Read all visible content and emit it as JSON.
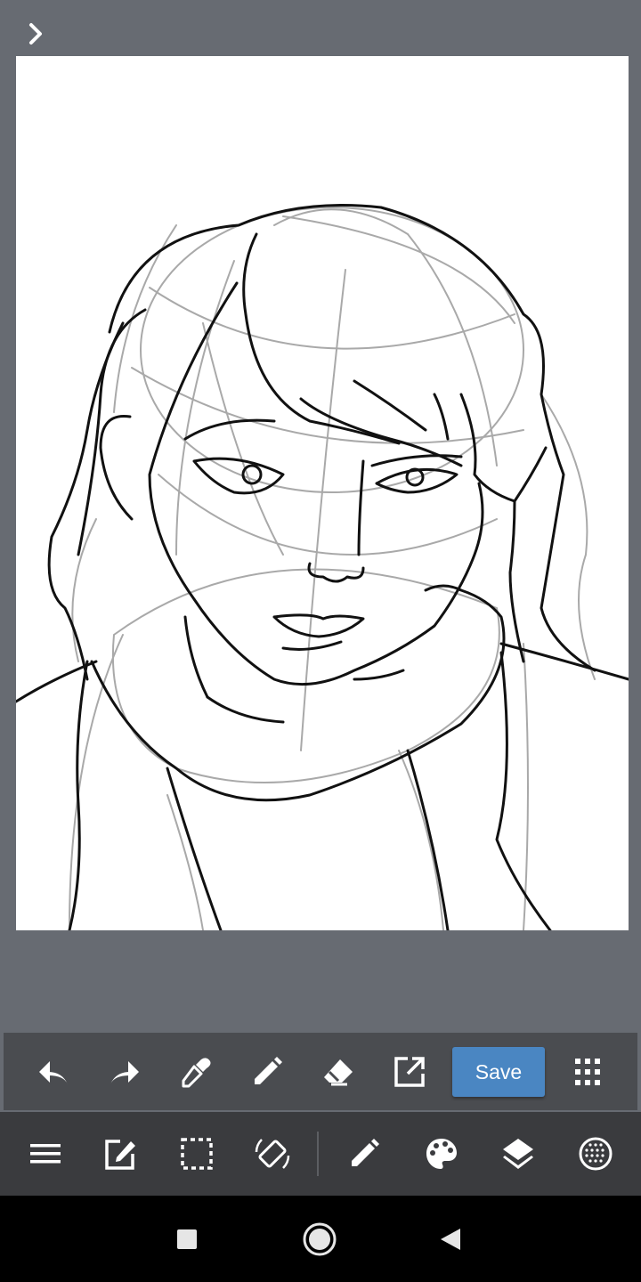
{
  "app": {
    "name": "drawing-editor"
  },
  "topbar": {
    "expand_icon": "chevron-right-icon"
  },
  "canvas": {
    "background": "#ffffff",
    "content": "pencil-sketch-portrait"
  },
  "toolbar_primary": {
    "items": [
      {
        "name": "undo",
        "icon": "undo-icon"
      },
      {
        "name": "redo",
        "icon": "redo-icon"
      },
      {
        "name": "eyedropper",
        "icon": "eyedropper-icon"
      },
      {
        "name": "pen",
        "icon": "pencil-icon"
      },
      {
        "name": "eraser",
        "icon": "eraser-icon"
      },
      {
        "name": "export",
        "icon": "open-external-icon"
      },
      {
        "name": "menu-grid",
        "icon": "dots-grid-icon"
      }
    ],
    "save_label": "Save"
  },
  "toolbar_secondary": {
    "items": [
      {
        "name": "menu",
        "icon": "hamburger-menu-icon"
      },
      {
        "name": "edit",
        "icon": "edit-square-icon"
      },
      {
        "name": "selection",
        "icon": "selection-marquee-icon"
      },
      {
        "name": "rotate",
        "icon": "screen-rotate-icon"
      },
      {
        "name": "brush",
        "icon": "pencil-icon"
      },
      {
        "name": "color",
        "icon": "palette-icon"
      },
      {
        "name": "layers",
        "icon": "layers-icon"
      },
      {
        "name": "texture",
        "icon": "dotted-circle-icon"
      }
    ]
  },
  "navigation_bar": {
    "items": [
      {
        "name": "recents",
        "icon": "square-icon"
      },
      {
        "name": "home",
        "icon": "home-circle-icon"
      },
      {
        "name": "back",
        "icon": "back-triangle-icon"
      }
    ]
  },
  "colors": {
    "background": "#676b72",
    "toolbar_primary": "#4a4c50",
    "toolbar_secondary": "#3a3b3e",
    "accent": "#4a86c2",
    "navigation_bar": "#000000"
  }
}
